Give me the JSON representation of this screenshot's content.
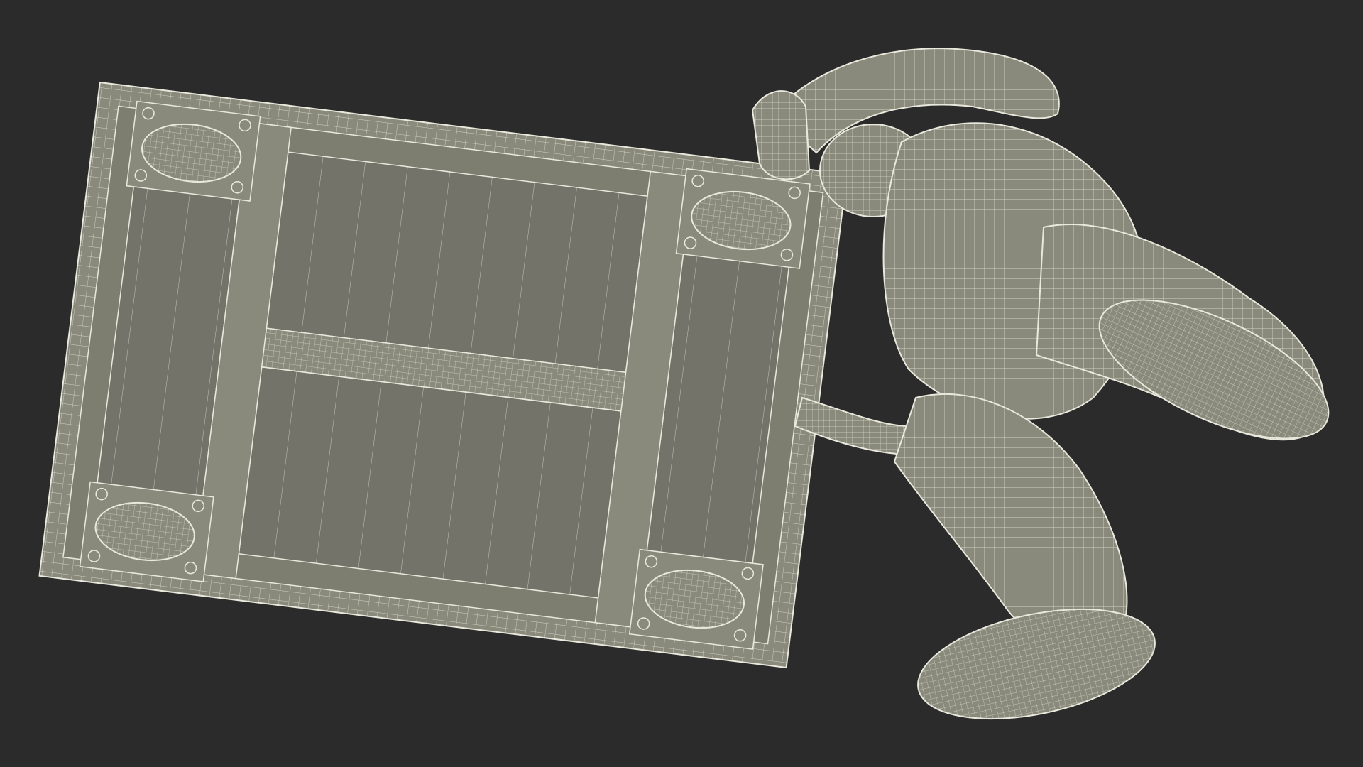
{
  "scene": {
    "background_color": "#2b2b2b",
    "mesh_fill_color": "#8a8a7c",
    "mesh_dark_color": "#6e6e62",
    "wire_color": "#e8e8dc",
    "cart_interior_color": "#73736a",
    "icons": {
      "cart": "platform-cart-icon",
      "wheel": "caster-wheel-icon",
      "person": "worker-figure-icon"
    }
  }
}
